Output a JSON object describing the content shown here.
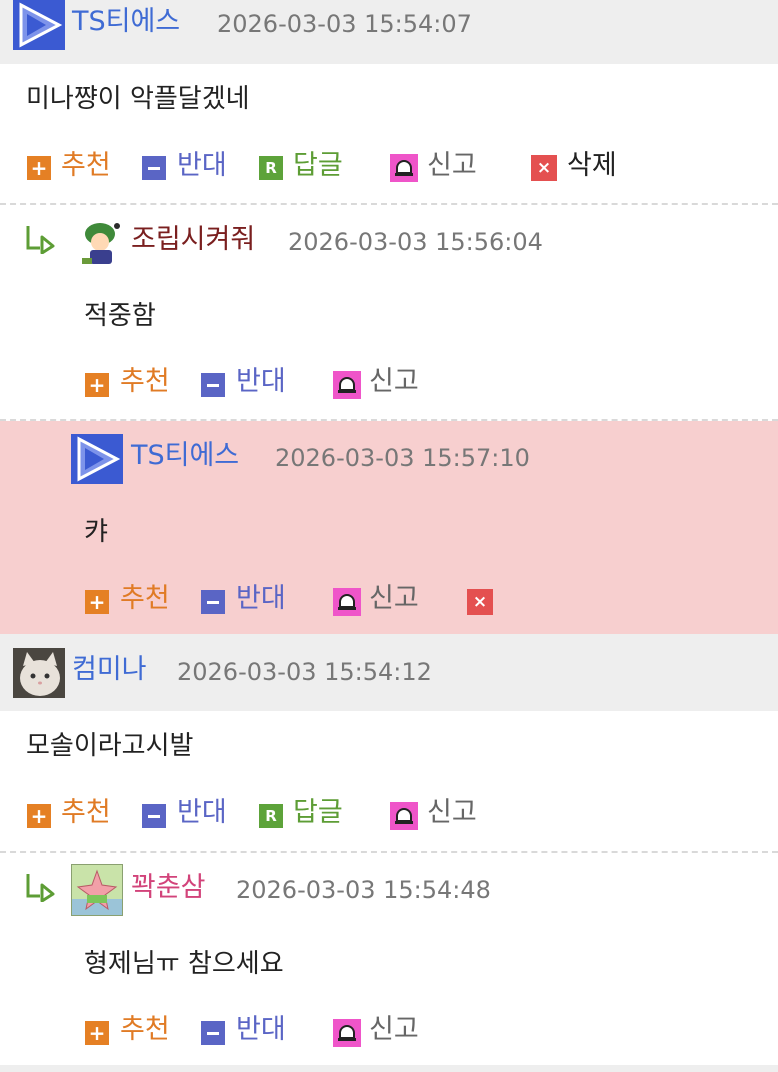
{
  "comments": [
    {
      "author": "TS티에스",
      "author_color": "#3f6bd4",
      "timestamp": "2026-03-03 15:54:07",
      "content": "미나쨩이 악플달겠네",
      "actions": {
        "up": "추천",
        "down": "반대",
        "reply": "답글",
        "report": "신고",
        "delete": "삭제"
      }
    },
    {
      "author": "조립시켜줘",
      "author_color": "#7a1f1f",
      "timestamp": "2026-03-03 15:56:04",
      "content": "적중함",
      "actions": {
        "up": "추천",
        "down": "반대",
        "report": "신고"
      }
    },
    {
      "author": "TS티에스",
      "author_color": "#3f6bd4",
      "timestamp": "2026-03-03 15:57:10",
      "content": "캬",
      "highlight_color": "#f7cfcf",
      "actions": {
        "up": "추천",
        "down": "반대",
        "report": "신고"
      }
    },
    {
      "author": "컴미나",
      "author_color": "#3f6bd4",
      "timestamp": "2026-03-03 15:54:12",
      "content": "모솔이라고시발",
      "actions": {
        "up": "추천",
        "down": "반대",
        "reply": "답글",
        "report": "신고"
      }
    },
    {
      "author": "꽉춘삼",
      "author_color": "#d2437a",
      "timestamp": "2026-03-03 15:54:48",
      "content": "형제님ㅠ 참으세요",
      "actions": {
        "up": "추천",
        "down": "반대",
        "report": "신고"
      }
    }
  ],
  "icons": {
    "plus_glyph": "+",
    "reply_glyph": "R",
    "delete_glyph": "×",
    "reply_arrow": "reply-arrow-icon",
    "report": "siren-icon"
  }
}
